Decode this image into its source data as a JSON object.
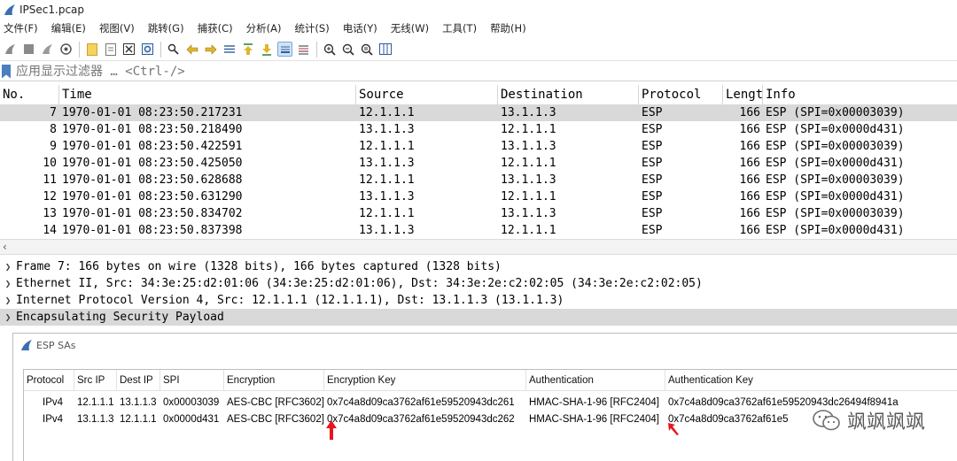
{
  "window": {
    "title": "IPSec1.pcap"
  },
  "menu": [
    "文件(F)",
    "编辑(E)",
    "视图(V)",
    "跳转(G)",
    "捕获(C)",
    "分析(A)",
    "统计(S)",
    "电话(Y)",
    "无线(W)",
    "工具(T)",
    "帮助(H)"
  ],
  "filter": {
    "placeholder": "应用显示过滤器 … <Ctrl-/>"
  },
  "packet_list": {
    "columns": [
      "No.",
      "Time",
      "Source",
      "Destination",
      "Protocol",
      "Lengt",
      "Info"
    ],
    "rows": [
      {
        "no": "7",
        "time": "1970-01-01 08:23:50.217231",
        "src": "12.1.1.1",
        "dst": "13.1.1.3",
        "proto": "ESP",
        "len": "166",
        "info": "ESP (SPI=0x00003039)"
      },
      {
        "no": "8",
        "time": "1970-01-01 08:23:50.218490",
        "src": "13.1.1.3",
        "dst": "12.1.1.1",
        "proto": "ESP",
        "len": "166",
        "info": "ESP (SPI=0x0000d431)"
      },
      {
        "no": "9",
        "time": "1970-01-01 08:23:50.422591",
        "src": "12.1.1.1",
        "dst": "13.1.1.3",
        "proto": "ESP",
        "len": "166",
        "info": "ESP (SPI=0x00003039)"
      },
      {
        "no": "10",
        "time": "1970-01-01 08:23:50.425050",
        "src": "13.1.1.3",
        "dst": "12.1.1.1",
        "proto": "ESP",
        "len": "166",
        "info": "ESP (SPI=0x0000d431)"
      },
      {
        "no": "11",
        "time": "1970-01-01 08:23:50.628688",
        "src": "12.1.1.1",
        "dst": "13.1.1.3",
        "proto": "ESP",
        "len": "166",
        "info": "ESP (SPI=0x00003039)"
      },
      {
        "no": "12",
        "time": "1970-01-01 08:23:50.631290",
        "src": "13.1.1.3",
        "dst": "12.1.1.1",
        "proto": "ESP",
        "len": "166",
        "info": "ESP (SPI=0x0000d431)"
      },
      {
        "no": "13",
        "time": "1970-01-01 08:23:50.834702",
        "src": "12.1.1.1",
        "dst": "13.1.1.3",
        "proto": "ESP",
        "len": "166",
        "info": "ESP (SPI=0x00003039)"
      },
      {
        "no": "14",
        "time": "1970-01-01 08:23:50.837398",
        "src": "13.1.1.3",
        "dst": "12.1.1.1",
        "proto": "ESP",
        "len": "166",
        "info": "ESP (SPI=0x0000d431)"
      }
    ]
  },
  "details": [
    "Frame 7: 166 bytes on wire (1328 bits), 166 bytes captured (1328 bits)",
    "Ethernet II, Src: 34:3e:25:d2:01:06 (34:3e:25:d2:01:06), Dst: 34:3e:2e:c2:02:05 (34:3e:2e:c2:02:05)",
    "Internet Protocol Version 4, Src: 12.1.1.1 (12.1.1.1), Dst: 13.1.1.3 (13.1.1.3)",
    "Encapsulating Security Payload"
  ],
  "esp_dialog": {
    "title": "ESP SAs",
    "columns": [
      "Protocol",
      "Src IP",
      "Dest IP",
      "SPI",
      "Encryption",
      "Encryption Key",
      "Authentication",
      "Authentication Key"
    ],
    "rows": [
      {
        "protocol": "IPv4",
        "src": "12.1.1.1",
        "dst": "13.1.1.3",
        "spi": "0x00003039",
        "enc": "AES-CBC [RFC3602]",
        "enc_key": "0x7c4a8d09ca3762af61e59520943dc261",
        "auth": "HMAC-SHA-1-96 [RFC2404]",
        "auth_key": "0x7c4a8d09ca3762af61e59520943dc26494f8941a"
      },
      {
        "protocol": "IPv4",
        "src": "13.1.1.3",
        "dst": "12.1.1.1",
        "spi": "0x0000d431",
        "enc": "AES-CBC [RFC3602]",
        "enc_key": "0x7c4a8d09ca3762af61e59520943dc262",
        "auth": "HMAC-SHA-1-96 [RFC2404]",
        "auth_key": "0x7c4a8d09ca3762af61e5"
      }
    ]
  },
  "watermark": {
    "text": "飒飒飒飒"
  },
  "colors": {
    "selected_row": "#d9d9d9",
    "accent": "#4a7fc0",
    "annotation": "#e8141e"
  }
}
